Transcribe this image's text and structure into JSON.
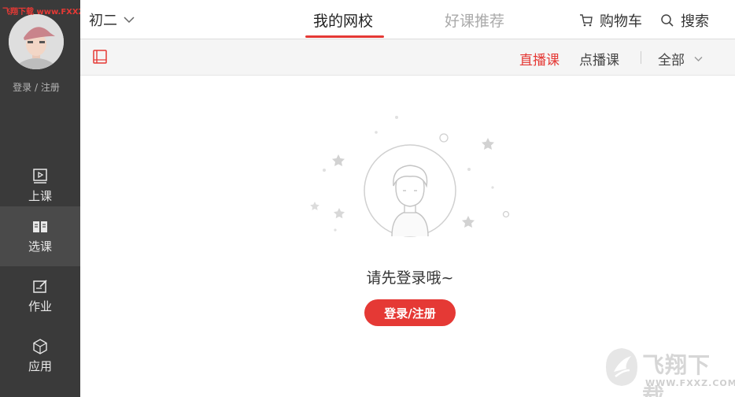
{
  "watermark": {
    "top_left": "飞翔下载 www.FXXZ.com",
    "brand": "飞翔下载",
    "url": "WWW.FXXZ.COM"
  },
  "sidebar": {
    "login_link": "登录 / 注册",
    "items": [
      {
        "label": "上课",
        "icon": "play-lesson-icon"
      },
      {
        "label": "选课",
        "icon": "book-open-icon",
        "active": true
      },
      {
        "label": "作业",
        "icon": "homework-edit-icon"
      },
      {
        "label": "应用",
        "icon": "cube-app-icon"
      }
    ]
  },
  "topbar": {
    "grade": "初二",
    "tabs": [
      {
        "label": "我的网校",
        "active": true
      },
      {
        "label": "好课推荐",
        "active": false
      }
    ],
    "cart": "购物车",
    "search": "搜索"
  },
  "filterbar": {
    "options": [
      "直播课",
      "点播课"
    ],
    "selected": "直播课",
    "scope": "全部"
  },
  "empty_state": {
    "message": "请先登录哦~",
    "button": "登录/注册"
  },
  "colors": {
    "accent": "#e53935",
    "sidebar_bg": "#3a3a3a",
    "sidebar_active": "#4a4a4a"
  }
}
